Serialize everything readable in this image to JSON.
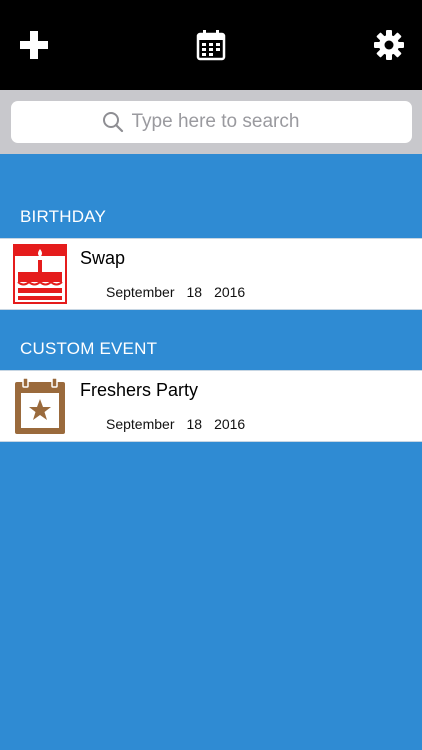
{
  "toolbar": {
    "add_icon": "plus-icon",
    "calendar_icon": "calendar-icon",
    "settings_icon": "gear-icon"
  },
  "search": {
    "placeholder": "Type here to search",
    "icon": "search-icon"
  },
  "sections": [
    {
      "header": "BIRTHDAY",
      "items": [
        {
          "title": "Swap",
          "icon": "birthday-cake-icon",
          "icon_color": "#e51c1c",
          "date": {
            "month": "September",
            "day": "18",
            "year": "2016"
          }
        }
      ]
    },
    {
      "header": "CUSTOM EVENT",
      "items": [
        {
          "title": "Freshers Party",
          "icon": "calendar-star-icon",
          "icon_color": "#9a6a3c",
          "date": {
            "month": "September",
            "day": "18",
            "year": "2016"
          }
        }
      ]
    }
  ],
  "colors": {
    "background": "#2f8bd3",
    "topbar": "#000000",
    "search_bar": "#c8c8cc"
  }
}
